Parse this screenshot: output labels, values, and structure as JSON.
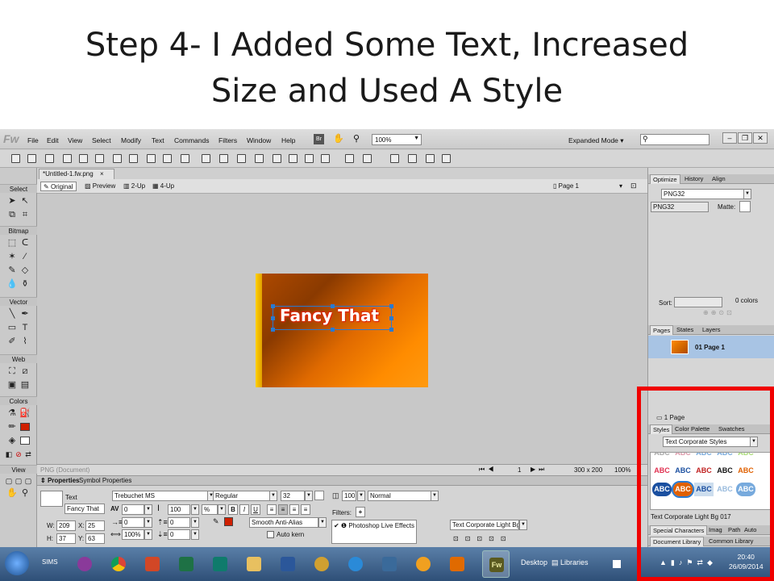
{
  "slide": {
    "title_line1": "Step 4- I Added Some Text, Increased",
    "title_line2": "Size and Used A Style"
  },
  "app": {
    "logo": "Fw",
    "menu": [
      "File",
      "Edit",
      "View",
      "Select",
      "Modify",
      "Text",
      "Commands",
      "Filters",
      "Window",
      "Help"
    ],
    "br_label": "Br",
    "zoom": "100%",
    "workspace": "Expanded Mode",
    "doc_tab": "*Untitled-1.fw.png",
    "views": [
      "Original",
      "Preview",
      "2-Up",
      "4-Up"
    ],
    "page_selector": "Page 1",
    "artwork_text": "Fancy That",
    "status_left": "PNG (Document)",
    "status_frame": "1",
    "status_size": "300 x 200",
    "status_zoom": "100%"
  },
  "tools": {
    "sections": [
      "Select",
      "Bitmap",
      "Vector",
      "Web",
      "Colors",
      "View"
    ]
  },
  "properties": {
    "tabs": [
      "Properties",
      "Symbol Properties"
    ],
    "object_type": "Text",
    "object_name": "Fancy That",
    "font": "Trebuchet MS",
    "style": "Regular",
    "size": "32",
    "opacity": "100",
    "blend": "Normal",
    "tracking": "0",
    "leading": "100",
    "leading_unit": "%",
    "indent": "0",
    "space_before": "0",
    "space_after": "0",
    "horizontal_scale": "100%",
    "w_label": "W:",
    "w": "209",
    "x_label": "X:",
    "x": "25",
    "h_label": "H:",
    "h": "37",
    "y_label": "Y:",
    "y": "63",
    "bold": "B",
    "italic": "I",
    "underline": "U",
    "antialias": "Smooth Anti-Alias",
    "autokern": "Auto kern",
    "filters_label": "Filters:",
    "live_effect": "Photoshop Live Effects",
    "style_name": "Text Corporate Light Bg"
  },
  "optimize": {
    "tabs": [
      "Optimize",
      "History",
      "Align"
    ],
    "format": "PNG32",
    "format2": "PNG32",
    "matte": "Matte:",
    "sort": "Sort:",
    "colors": "0 colors"
  },
  "pages": {
    "tabs": [
      "Pages",
      "States",
      "Layers"
    ],
    "page_name": "01  Page 1",
    "count": "1 Page"
  },
  "styles": {
    "tabs": [
      "Styles",
      "Color Palette",
      "Swatches"
    ],
    "library": "Text Corporate Styles",
    "cells": [
      "ABC",
      "ABC",
      "ABC",
      "ABC",
      "ABC",
      "ABC",
      "ABC",
      "ABC",
      "ABC",
      "ABC",
      "ABC",
      "ABC",
      "ABC",
      "ABC",
      "ABC"
    ],
    "selected_name": "Text Corporate Light Bg 017"
  },
  "bottom_tabs": {
    "row1": [
      "Special Characters",
      "Imag",
      "Path",
      "Auto"
    ],
    "row2": [
      "Document Library",
      "Common Library"
    ]
  },
  "taskbar": {
    "sims": "SIMS",
    "desktop": "Desktop",
    "libraries": "Libraries",
    "fw_label": "Fw",
    "time": "20:40",
    "date": "26/09/2014"
  }
}
